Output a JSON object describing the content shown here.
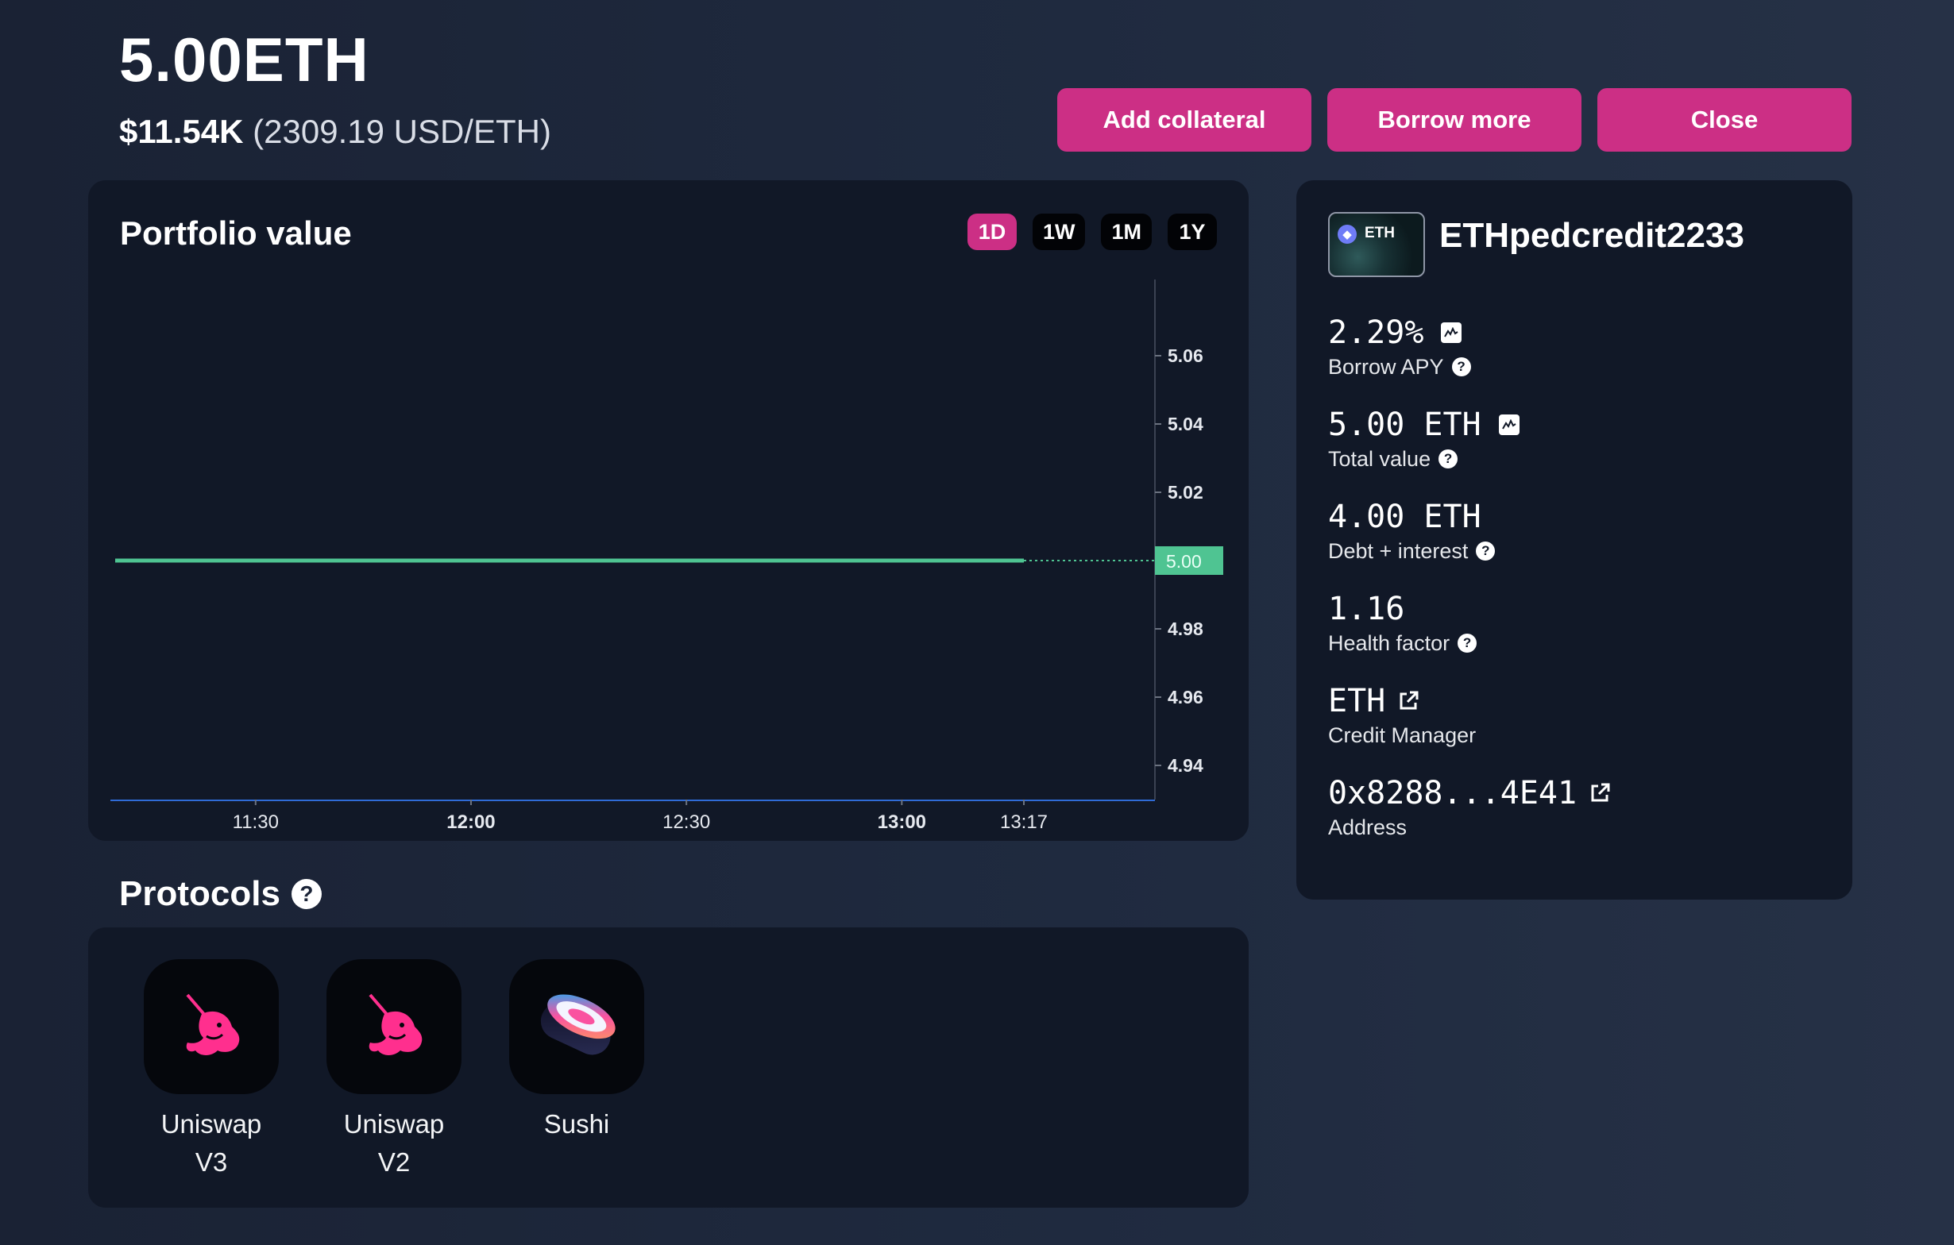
{
  "header": {
    "balance": "5.00ETH",
    "usd_value": "$11.54K",
    "rate": "(2309.19 USD/ETH)"
  },
  "actions": {
    "add_collateral": "Add collateral",
    "borrow_more": "Borrow more",
    "close": "Close"
  },
  "colors": {
    "accent": "#cc2f85",
    "line": "#4fc492",
    "card": "#111827"
  },
  "portfolio": {
    "title": "Portfolio value",
    "ranges": [
      "1D",
      "1W",
      "1M",
      "1Y"
    ],
    "active_range": "1D",
    "current_value_label": "5.00"
  },
  "chart_data": {
    "type": "line",
    "title": "Portfolio value",
    "xlabel": "",
    "ylabel": "",
    "x_ticks": [
      {
        "label": "11:30",
        "bold": false
      },
      {
        "label": "12:00",
        "bold": true
      },
      {
        "label": "12:30",
        "bold": false
      },
      {
        "label": "13:00",
        "bold": true
      },
      {
        "label": "13:17",
        "bold": false
      }
    ],
    "y_ticks": [
      "5.06",
      "5.04",
      "5.02",
      "5.00",
      "4.98",
      "4.96",
      "4.94"
    ],
    "ylim": [
      4.93,
      5.08
    ],
    "x_range": [
      "11:10",
      "13:17"
    ],
    "series": [
      {
        "values": [
          5.0,
          5.0,
          5.0,
          5.0,
          5.0,
          5.0,
          5.0
        ]
      }
    ],
    "current_value": 5.0,
    "grid": false
  },
  "protocols": {
    "title": "Protocols",
    "items": [
      {
        "label": "Uniswap V3",
        "icon": "uniswap-icon"
      },
      {
        "label": "Uniswap V2",
        "icon": "uniswap-icon"
      },
      {
        "label": "Sushi",
        "icon": "sushi-icon"
      }
    ]
  },
  "account": {
    "avatar_badge": "ETH",
    "name": "ETHpedcredit2233",
    "stats": [
      {
        "value": "2.29%",
        "label": "Borrow APY",
        "value_icon": "chart-icon",
        "label_icon": "help-icon"
      },
      {
        "value": "5.00 ETH",
        "label": "Total value",
        "value_icon": "chart-icon",
        "label_icon": "help-icon"
      },
      {
        "value": "4.00 ETH",
        "label": "Debt + interest",
        "value_icon": "",
        "label_icon": "help-icon"
      },
      {
        "value": "1.16",
        "label": "Health factor",
        "value_icon": "",
        "label_icon": "help-icon"
      },
      {
        "value": "ETH",
        "label": "Credit Manager",
        "value_icon": "external-link-icon",
        "label_icon": ""
      },
      {
        "value": "0x8288...4E41",
        "label": "Address",
        "value_icon": "external-link-icon",
        "label_icon": ""
      }
    ]
  }
}
